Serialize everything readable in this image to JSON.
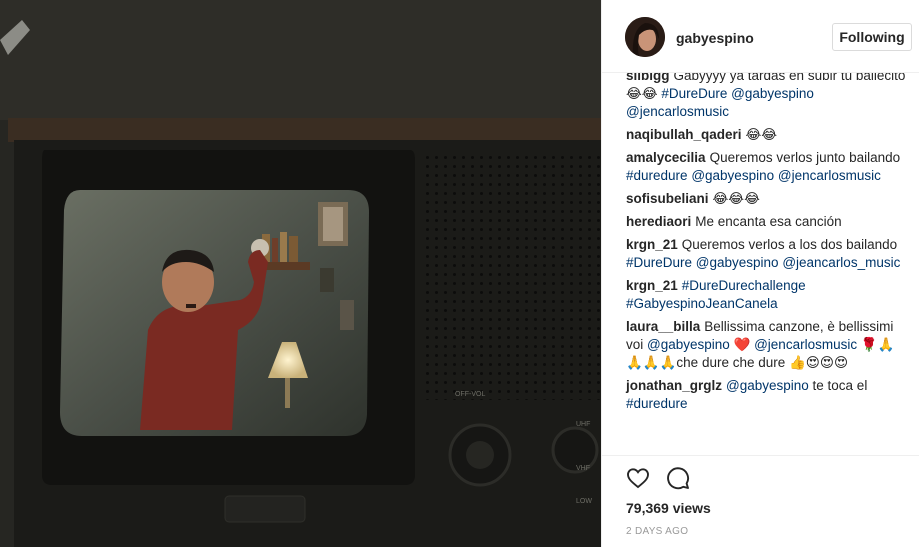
{
  "post": {
    "author": "gabyespino",
    "follow_label": "Following",
    "views": "79,369 views",
    "date": "2 DAYS AGO"
  },
  "media": {
    "panel_text_top": "OFF-VOL",
    "panel_text_right_1": "UHF",
    "panel_text_right_2": "VHF",
    "panel_text_right_3": "LOW"
  },
  "comments": [
    {
      "user": "slibigg",
      "parts": [
        {
          "t": "Gabyyyy ya tardas en subir tu bailecito 😂😂 "
        },
        {
          "t": "#DureDure",
          "tag": true
        },
        {
          "t": " "
        },
        {
          "t": "@gabyespino",
          "tag": true
        },
        {
          "t": " "
        },
        {
          "t": "@jencarlosmusic",
          "tag": true
        }
      ]
    },
    {
      "user": "naqibullah_qaderi",
      "parts": [
        {
          "t": "😂😂"
        }
      ]
    },
    {
      "user": "amalycecilia",
      "parts": [
        {
          "t": "Queremos verlos junto bailando "
        },
        {
          "t": "#duredure",
          "tag": true
        },
        {
          "t": " "
        },
        {
          "t": "@gabyespino",
          "tag": true
        },
        {
          "t": " "
        },
        {
          "t": "@jencarlosmusic",
          "tag": true
        }
      ]
    },
    {
      "user": "sofisubeliani",
      "parts": [
        {
          "t": "😂😂😂"
        }
      ]
    },
    {
      "user": "herediaori",
      "parts": [
        {
          "t": "Me encanta esa canción"
        }
      ]
    },
    {
      "user": "krgn_21",
      "parts": [
        {
          "t": "Queremos verlos a los dos bailando "
        },
        {
          "t": "#DureDure",
          "tag": true
        },
        {
          "t": " "
        },
        {
          "t": "@gabyespino",
          "tag": true
        },
        {
          "t": " "
        },
        {
          "t": "@jeancarlos_music",
          "tag": true
        }
      ]
    },
    {
      "user": "krgn_21",
      "parts": [
        {
          "t": "#DureDurechallenge",
          "tag": true
        },
        {
          "t": " "
        },
        {
          "t": "#GabyespinoJeanCanela",
          "tag": true
        }
      ]
    },
    {
      "user": "laura__billa",
      "parts": [
        {
          "t": "Bellissima canzone, è bellissimi voi "
        },
        {
          "t": "@gabyespino",
          "tag": true
        },
        {
          "t": " ❤️ "
        },
        {
          "t": "@jencarlosmusic",
          "tag": true
        },
        {
          "t": " 🌹🙏🙏🙏🙏che dure che dure 👍😍😍😍"
        }
      ]
    },
    {
      "user": "jonathan_grglz",
      "parts": [
        {
          "t": "@gabyespino",
          "tag": true
        },
        {
          "t": " te toca el "
        },
        {
          "t": "#duredure",
          "tag": true
        }
      ]
    }
  ],
  "icons": {
    "like": "heart-outline",
    "comment": "speech-bubble"
  },
  "colors": {
    "tag": "#003569",
    "text": "#262626",
    "muted": "#999999",
    "border": "#dbdbdb"
  }
}
